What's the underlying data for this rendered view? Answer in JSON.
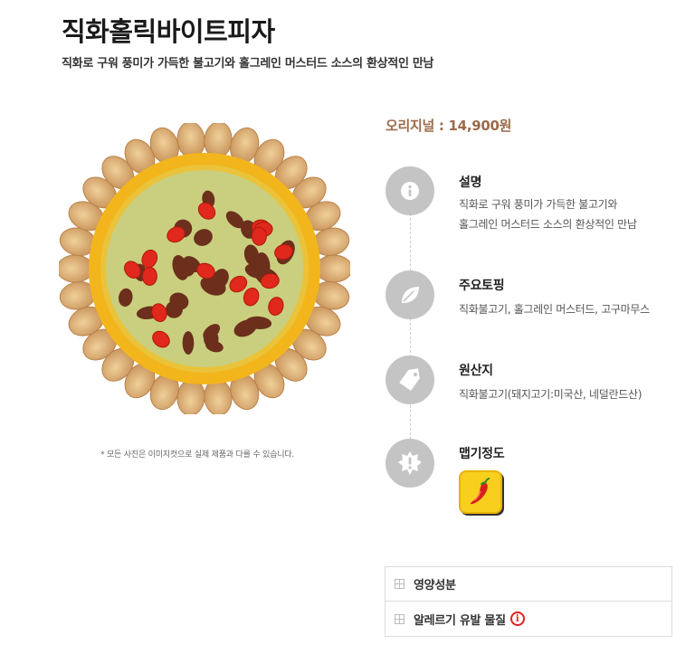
{
  "product": {
    "title": "직화홀릭바이트피자",
    "subtitle": "직화로 구워 풍미가 가득한 불고기와 홀그레인 머스터드 소스의 환상적인 만남"
  },
  "image": {
    "disclaimer": "* 모든 사진은 이미지컷으로 실제 제품과 다를 수 있습니다."
  },
  "price": {
    "label": "오리지널 : 14,900원"
  },
  "info": {
    "description": {
      "title": "설명",
      "line1": "직화로 구워 풍미가 가득한 불고기와",
      "line2": "홀그레인 머스터드 소스의 환상적인 만남",
      "icon": "info-icon"
    },
    "toppings": {
      "title": "주요토핑",
      "text": "직화불고기, 홀그레인 머스터드, 고구마무스",
      "icon": "leaf-icon"
    },
    "origin": {
      "title": "원산지",
      "text": "직화불고기(돼지고기:미국산, 네덜란드산)",
      "icon": "tag-icon"
    },
    "spicy": {
      "title": "맵기정도",
      "icon": "warning-icon",
      "badge_icon": "chili-pepper-icon"
    }
  },
  "accordion": {
    "nutrition": "영양성분",
    "allergy": "알레르기 유발 물질"
  },
  "colors": {
    "price": "#9b6b4a",
    "icon_bg": "#c4c4c4",
    "spicy_badge": "#f8cf1d",
    "alert": "#e02020"
  }
}
